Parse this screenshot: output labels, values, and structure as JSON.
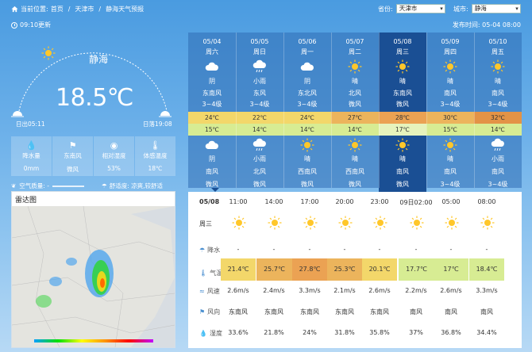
{
  "breadcrumb": {
    "location_label": "当前位置:",
    "items": [
      "首页",
      "天津市",
      "静海天气预报"
    ]
  },
  "selectors": {
    "province_label": "省份:",
    "province_value": "天津市",
    "city_label": "城市:",
    "city_value": "静海"
  },
  "update_time": "09:10更新",
  "publish_time": "发布时间: 05-04 08:00",
  "current": {
    "city": "静海",
    "temperature": "18.5℃",
    "sunrise": "日出05:11",
    "sunset": "日落19:08"
  },
  "conditions": [
    {
      "icon": "rain-drops-icon",
      "label": "降水量",
      "value": "0mm"
    },
    {
      "icon": "wind-icon",
      "label": "东南风",
      "value": "微风"
    },
    {
      "icon": "humidity-icon",
      "label": "相对湿度",
      "value": "53%"
    },
    {
      "icon": "thermometer-icon",
      "label": "体感温度",
      "value": "18℃"
    }
  ],
  "air_quality_label": "空气质量: -",
  "comfort_label": "舒适度: 凉爽,较舒适",
  "radar_title": "雷达图",
  "forecast": [
    {
      "date": "05/04",
      "weekday": "周六",
      "day_icon": "cloudy",
      "day_weather": "阴",
      "day_wind_dir": "东南风",
      "day_wind_speed": "3~4级",
      "high": "24℃",
      "low": "15℃",
      "night_icon": "cloudy",
      "night_weather": "阴",
      "night_wind_dir": "南风",
      "night_wind_speed": "微风"
    },
    {
      "date": "05/05",
      "weekday": "周日",
      "day_icon": "rain",
      "day_weather": "小雨",
      "day_wind_dir": "东风",
      "day_wind_speed": "3~4级",
      "high": "22℃",
      "low": "14℃",
      "night_icon": "rain",
      "night_weather": "小雨",
      "night_wind_dir": "北风",
      "night_wind_speed": "微风"
    },
    {
      "date": "05/06",
      "weekday": "周一",
      "day_icon": "cloudy",
      "day_weather": "阴",
      "day_wind_dir": "东北风",
      "day_wind_speed": "3~4级",
      "high": "24℃",
      "low": "14℃",
      "night_icon": "sunny",
      "night_weather": "晴",
      "night_wind_dir": "西南风",
      "night_wind_speed": "微风"
    },
    {
      "date": "05/07",
      "weekday": "周二",
      "day_icon": "sunny",
      "day_weather": "晴",
      "day_wind_dir": "北风",
      "day_wind_speed": "微风",
      "high": "27℃",
      "low": "14℃",
      "night_icon": "sunny",
      "night_weather": "晴",
      "night_wind_dir": "西南风",
      "night_wind_speed": "微风"
    },
    {
      "date": "05/08",
      "weekday": "周三",
      "day_icon": "sunny",
      "day_weather": "晴",
      "day_wind_dir": "东南风",
      "day_wind_speed": "微风",
      "high": "28℃",
      "low": "17℃",
      "night_icon": "sunny",
      "night_weather": "晴",
      "night_wind_dir": "南风",
      "night_wind_speed": "微风"
    },
    {
      "date": "05/09",
      "weekday": "周四",
      "day_icon": "sunny",
      "day_weather": "晴",
      "day_wind_dir": "南风",
      "day_wind_speed": "3~4级",
      "high": "30℃",
      "low": "15℃",
      "night_icon": "sunny",
      "night_weather": "晴",
      "night_wind_dir": "南风",
      "night_wind_speed": "3~4级"
    },
    {
      "date": "05/10",
      "weekday": "周五",
      "day_icon": "sunny",
      "day_weather": "晴",
      "day_wind_dir": "南风",
      "day_wind_speed": "3~4级",
      "high": "32℃",
      "low": "14℃",
      "night_icon": "rain",
      "night_weather": "小雨",
      "night_wind_dir": "南风",
      "night_wind_speed": "3~4级"
    }
  ],
  "high_colors": [
    "#f3d76a",
    "#f3d76a",
    "#f3d76a",
    "#ecb45c",
    "#eba253",
    "#ecb45c",
    "#e39346"
  ],
  "low_colors": [
    "#d7ec93",
    "#d7ec93",
    "#d7ec93",
    "#d7ec93",
    "#e6f3bc",
    "#d7ec93",
    "#d7ec93"
  ],
  "hourly": {
    "date": "05/08",
    "weekday": "周三",
    "times": [
      "11:00",
      "14:00",
      "17:00",
      "20:00",
      "23:00",
      "09日02:00",
      "05:00",
      "08:00"
    ],
    "precip_label": "降水",
    "precip": [
      "-",
      "-",
      "-",
      "-",
      "-",
      "-",
      "-",
      "-"
    ],
    "temp_label": "气温",
    "temps": [
      "21.4℃",
      "25.7℃",
      "27.8℃",
      "25.3℃",
      "20.1℃",
      "17.7℃",
      "17℃",
      "18.4℃"
    ],
    "temp_colors": [
      "#f3d76a",
      "#ecb45c",
      "#eba253",
      "#ecb45c",
      "#f3d76a",
      "#d7ec93",
      "#d7ec93",
      "#d7ec93"
    ],
    "wind_speed_label": "风速",
    "wind_speeds": [
      "2.6m/s",
      "2.4m/s",
      "3.3m/s",
      "2.1m/s",
      "2.6m/s",
      "2.2m/s",
      "2.6m/s",
      "3.3m/s"
    ],
    "wind_dir_label": "风向",
    "wind_dirs": [
      "东南风",
      "东南风",
      "东南风",
      "东南风",
      "东南风",
      "南风",
      "南风",
      "南风"
    ],
    "humidity_label": "湿度",
    "humidity": [
      "33.6%",
      "21.8%",
      "24%",
      "31.8%",
      "35.8%",
      "37%",
      "36.8%",
      "34.4%"
    ]
  }
}
